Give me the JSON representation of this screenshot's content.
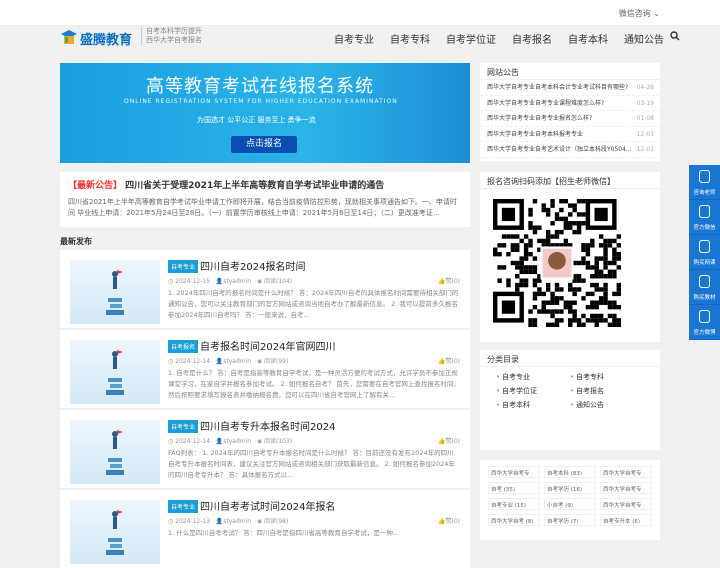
{
  "topbar": {
    "wechat": "微信咨询 ⌄"
  },
  "logo": {
    "name": "盛腾教育",
    "slogan1": "自考本科学历提升",
    "slogan2": "西华大学自考报名"
  },
  "nav": [
    "自考专业",
    "自考专科",
    "自考学位证",
    "自考报名",
    "自考本科",
    "通知公告"
  ],
  "banner": {
    "title": "高等教育考试在线报名系统",
    "subtitle": "ONLINE REGISTRATION SYSTEM FOR HIGHER EDUCATION EXAMINATION",
    "slogan": "为国选才  公平公正  服务至上  勇争一流",
    "button": "点击报名"
  },
  "notice": {
    "tag": "【最新公告】",
    "title": "四川省关于受理2021年上半年高等教育自学考试毕业申请的通告",
    "body": "四川省2021年上半年高等教育自学考试毕业申请工作即将开展，结合当前疫情防控形势，现就相关事项通告如下。一、申请时间 毕业线上申请：2021年5月24日至28日。（一）前置学历审核线上申请：2021年5月6日至14日；（二）更改准考证..."
  },
  "latest_label": "最新发布",
  "posts": [
    {
      "cat": "自考专业",
      "title": "四川自考2024报名时间",
      "date": "2024-12-15",
      "author": "styadmin",
      "views": "阅读(104)",
      "likes": "赞(0)",
      "excerpt": "1. 2024年四川自考的报名时间是什么时候？ 答：2024年四川自考的具体报名时间需要待相关部门的通知公告，您可以关注教育部门的官方网站或咨询当地自考办了解最新信息。 2. 我可以提前多久报名参加2024年四川自考吗？ 答：一般来说，自考..."
    },
    {
      "cat": "自考报名",
      "title": "自考报名时间2024年官网四川",
      "date": "2024-12-14",
      "author": "styadmin",
      "views": "阅读(99)",
      "likes": "赞(0)",
      "excerpt": "1. 自考是什么？ 答：自考是指高等教育自学考试，是一种灵活方便的考试方式，允许学员不参加正规课堂学习，在家自学并报名参加考试。 2. 如何报名自考？ 首先，您需要在自考官网上查找报名时间，然后按照要求填写报名表并缴纳报名费。您可以在四川省自考官网上了解有关..."
    },
    {
      "cat": "自考专业",
      "title": "四川自考专升本报名时间2024",
      "date": "2024-12-14",
      "author": "styadmin",
      "views": "阅读(103)",
      "likes": "赞(0)",
      "excerpt": "FAQ列表： 1. 2024年的四川自考专升本报名时间是什么时候？ 答：目前还没有发布2024年的四川自考专升本报名时间表，建议关注官方网站或咨询相关部门获取最新信息。 2. 如何报名参加2024年的四川自考专升本？ 答：具体报名方式以..."
    },
    {
      "cat": "自考专业",
      "title": "四川自考考试时间2024年报名",
      "date": "2024-12-13",
      "author": "styadmin",
      "views": "阅读(98)",
      "likes": "赞(0)",
      "excerpt": "1. 什么是四川自考考试？ 答：四川自考是指四川省高等教育自学考试，是一种..."
    }
  ],
  "sidebar": {
    "announce_title": "网站公告",
    "announcements": [
      {
        "text": "西华大学自考专业自考本科会计专业考试科目有哪些?",
        "date": "04-26"
      },
      {
        "text": "西华大学自考专业自考专业课程难度怎么样?",
        "date": "03-19"
      },
      {
        "text": "西华大学自考专业自考专业报名怎么样?",
        "date": "01-08"
      },
      {
        "text": "西华大学自考专业自考本科报考专业",
        "date": "12-03"
      },
      {
        "text": "西华大学自考专业自考艺术设计（独立本科段Y0504...",
        "date": "12-01"
      }
    ],
    "qr_title": "报名咨询扫码添加【招生老师微信】",
    "cat_title": "分类目录",
    "categories": [
      "自考专业",
      "自考专科",
      "自考学位证",
      "自考报名",
      "自考本科",
      "通知公告"
    ],
    "tags": [
      "西华大学自考专",
      "自考本科 (83)",
      "西华大学自考专",
      "自考 (35)",
      "自考学历 (16)",
      "西华大学自考专",
      "自考专业 (15)",
      "小自考 (9)",
      "西华大学自考专",
      "西华大学自考 (8)",
      "自考学历 (7)",
      "自考专升本 (6)"
    ]
  },
  "float": [
    "咨询老师",
    "官方微信",
    "购买网课",
    "购买教材",
    "官方微博"
  ]
}
